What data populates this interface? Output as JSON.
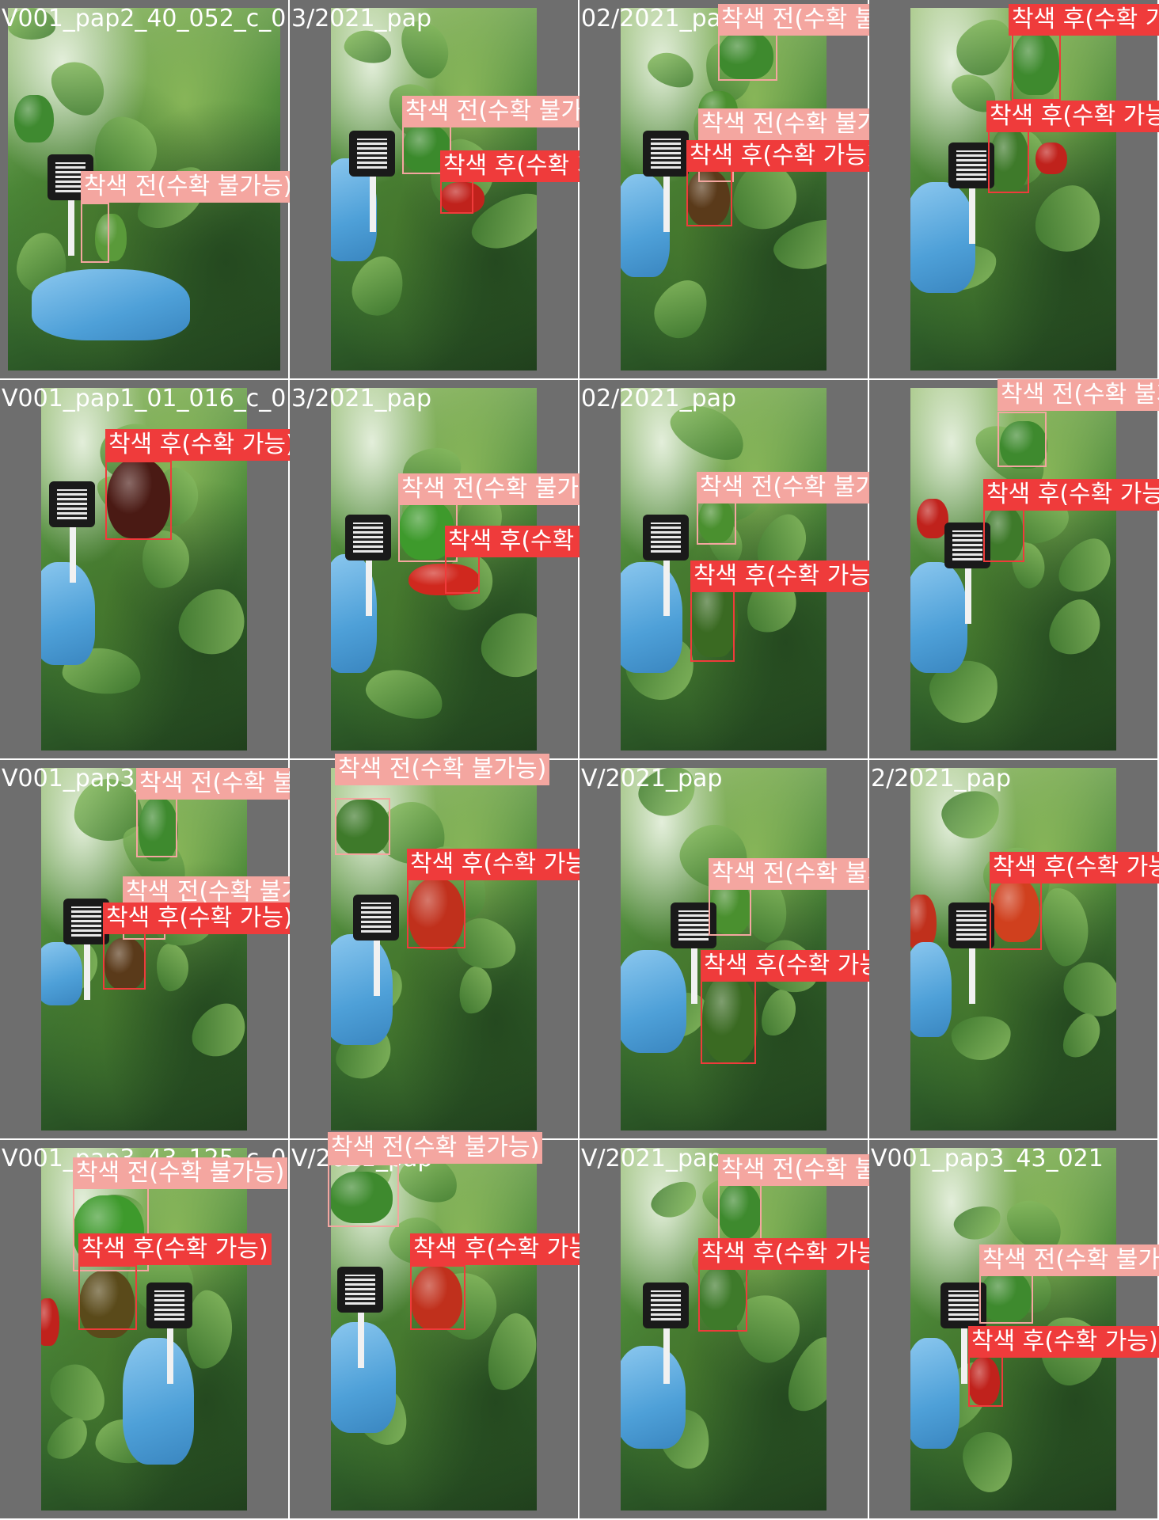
{
  "classes": {
    "before": {
      "label": "착색 전(수확 불가능)",
      "color": "#f4a6a0"
    },
    "after": {
      "label": "착색 후(수확 가능)",
      "color": "#ef3b3b"
    }
  },
  "tiles": [
    {
      "filename": "V001_pap2_40_052_c_0",
      "detections": [
        {
          "cls": "before"
        }
      ]
    },
    {
      "filename": "3/2021_pap",
      "detections": [
        {
          "cls": "before"
        },
        {
          "cls": "after"
        }
      ]
    },
    {
      "filename": "02/2021_pap",
      "detections": [
        {
          "cls": "before"
        },
        {
          "cls": "before"
        },
        {
          "cls": "after"
        }
      ]
    },
    {
      "filename": "",
      "detections": [
        {
          "cls": "after"
        },
        {
          "cls": "after"
        }
      ]
    },
    {
      "filename": "V001_pap1_01_016_c_0",
      "detections": [
        {
          "cls": "after"
        }
      ]
    },
    {
      "filename": "3/2021_pap",
      "detections": [
        {
          "cls": "before"
        },
        {
          "cls": "after"
        }
      ]
    },
    {
      "filename": "02/2021_pap",
      "detections": [
        {
          "cls": "before"
        },
        {
          "cls": "after"
        }
      ]
    },
    {
      "filename": "",
      "detections": [
        {
          "cls": "before"
        },
        {
          "cls": "after"
        }
      ]
    },
    {
      "filename": "V001_pap3_4",
      "detections": [
        {
          "cls": "before"
        },
        {
          "cls": "before"
        },
        {
          "cls": "after"
        }
      ]
    },
    {
      "filename": "",
      "detections": [
        {
          "cls": "before"
        },
        {
          "cls": "after"
        }
      ]
    },
    {
      "filename": "V/2021_pap",
      "detections": [
        {
          "cls": "before"
        },
        {
          "cls": "after"
        }
      ]
    },
    {
      "filename": "2/2021_pap",
      "detections": [
        {
          "cls": "after"
        }
      ]
    },
    {
      "filename": "V001_pap3_43_125_c_0",
      "detections": [
        {
          "cls": "before"
        },
        {
          "cls": "after"
        }
      ]
    },
    {
      "filename": "V/2021_pap",
      "detections": [
        {
          "cls": "before"
        },
        {
          "cls": "after"
        }
      ]
    },
    {
      "filename": "V/2021_pap",
      "detections": [
        {
          "cls": "before"
        },
        {
          "cls": "after"
        }
      ]
    },
    {
      "filename": "V001_pap3_43_021",
      "detections": [
        {
          "cls": "before"
        },
        {
          "cls": "after"
        }
      ]
    }
  ]
}
